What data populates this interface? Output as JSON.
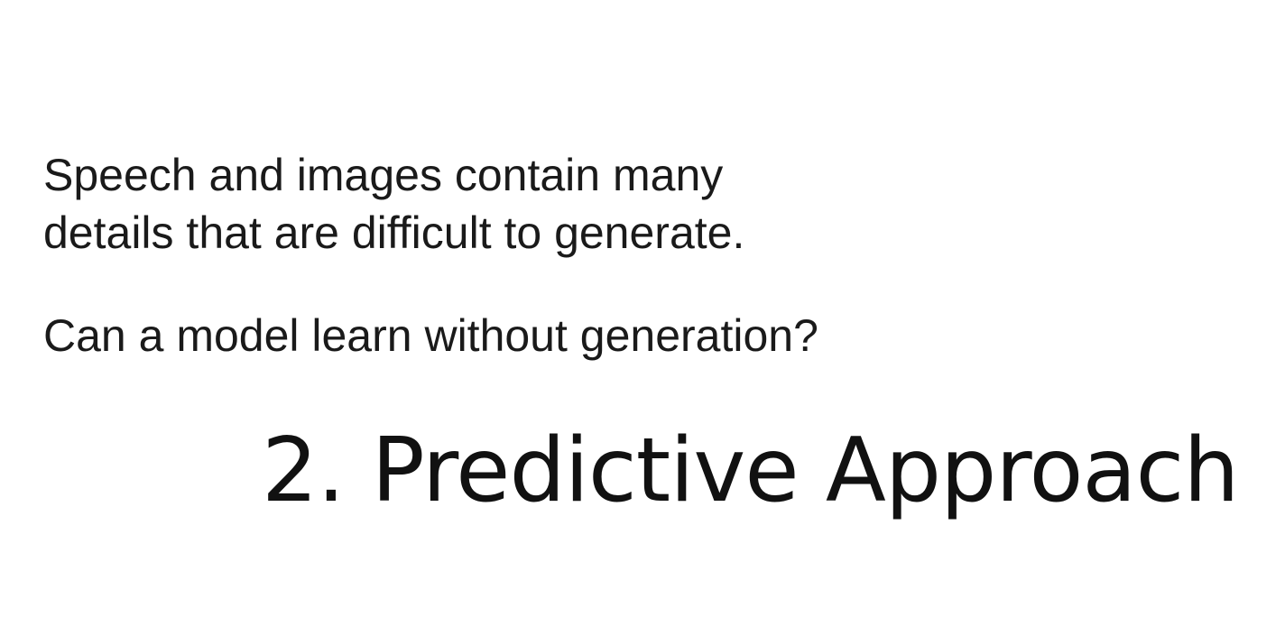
{
  "slide": {
    "paragraph_1": {
      "line_1": "Speech and images contain many",
      "line_2": "details that are difficult to generate."
    },
    "paragraph_2": "Can a model learn without generation?",
    "section_title": "2. Predictive Approach"
  },
  "colors": {
    "background": "#ffffff",
    "text": "#1a1a1a"
  }
}
